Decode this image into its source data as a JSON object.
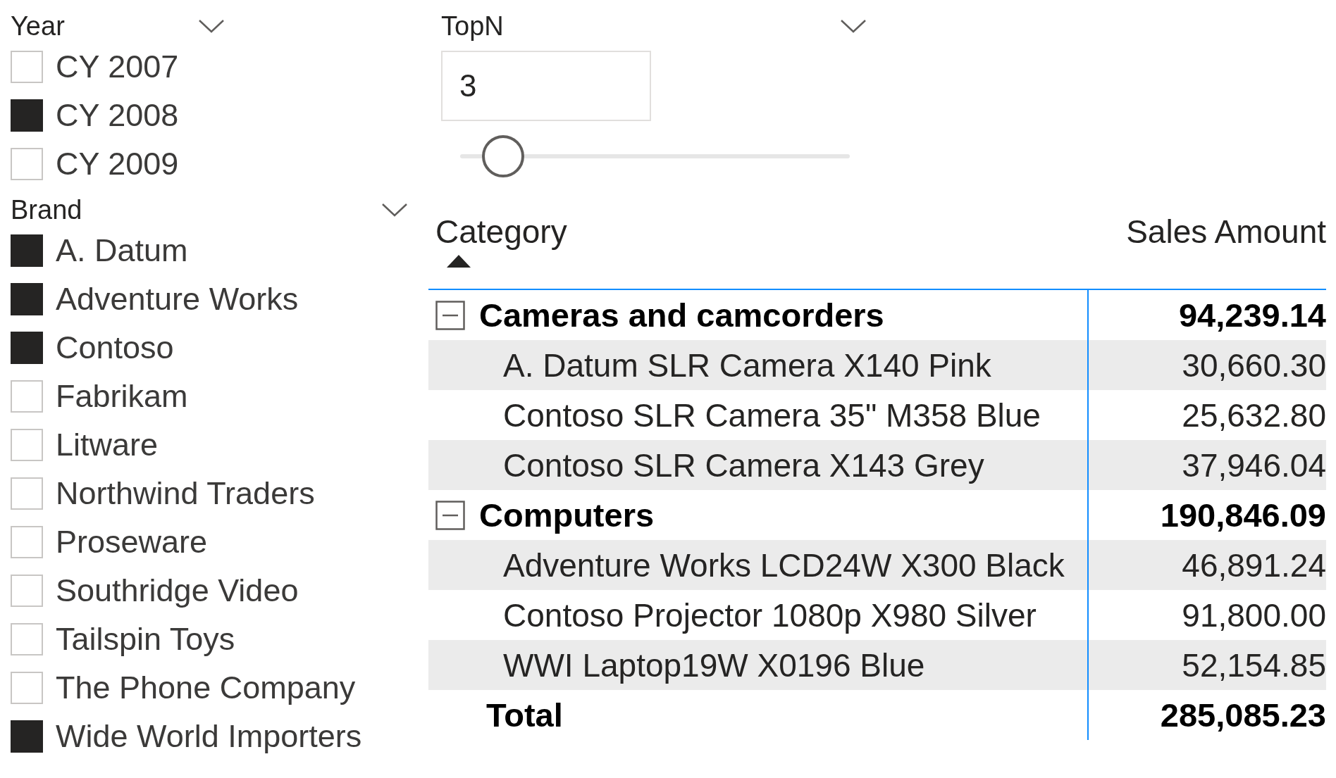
{
  "year_slicer": {
    "title": "Year",
    "items": [
      {
        "label": "CY 2007",
        "checked": false
      },
      {
        "label": "CY 2008",
        "checked": true
      },
      {
        "label": "CY 2009",
        "checked": false
      }
    ]
  },
  "brand_slicer": {
    "title": "Brand",
    "items": [
      {
        "label": "A. Datum",
        "checked": true
      },
      {
        "label": "Adventure Works",
        "checked": true
      },
      {
        "label": "Contoso",
        "checked": true
      },
      {
        "label": "Fabrikam",
        "checked": false
      },
      {
        "label": "Litware",
        "checked": false
      },
      {
        "label": "Northwind Traders",
        "checked": false
      },
      {
        "label": "Proseware",
        "checked": false
      },
      {
        "label": "Southridge Video",
        "checked": false
      },
      {
        "label": "Tailspin Toys",
        "checked": false
      },
      {
        "label": "The Phone Company",
        "checked": false
      },
      {
        "label": "Wide World Importers",
        "checked": true
      }
    ]
  },
  "topn_slicer": {
    "title": "TopN",
    "value": "3",
    "level": 0.11
  },
  "table": {
    "columns": [
      {
        "label": "Category",
        "sorted": true
      },
      {
        "label": "Sales Amount",
        "sorted": false
      }
    ],
    "groups": [
      {
        "name": "Cameras and camcorders",
        "total": "94,239.14",
        "expanded": true,
        "rows": [
          {
            "name": "A. Datum SLR Camera X140 Pink",
            "value": "30,660.30"
          },
          {
            "name": "Contoso SLR Camera 35\" M358 Blue",
            "value": "25,632.80"
          },
          {
            "name": "Contoso SLR Camera X143 Grey",
            "value": "37,946.04"
          }
        ]
      },
      {
        "name": "Computers",
        "total": "190,846.09",
        "expanded": true,
        "rows": [
          {
            "name": "Adventure Works LCD24W X300 Black",
            "value": "46,891.24"
          },
          {
            "name": "Contoso Projector 1080p X980 Silver",
            "value": "91,800.00"
          },
          {
            "name": "WWI Laptop19W X0196 Blue",
            "value": "52,154.85"
          }
        ]
      }
    ],
    "total": {
      "label": "Total",
      "value": "285,085.23"
    }
  }
}
